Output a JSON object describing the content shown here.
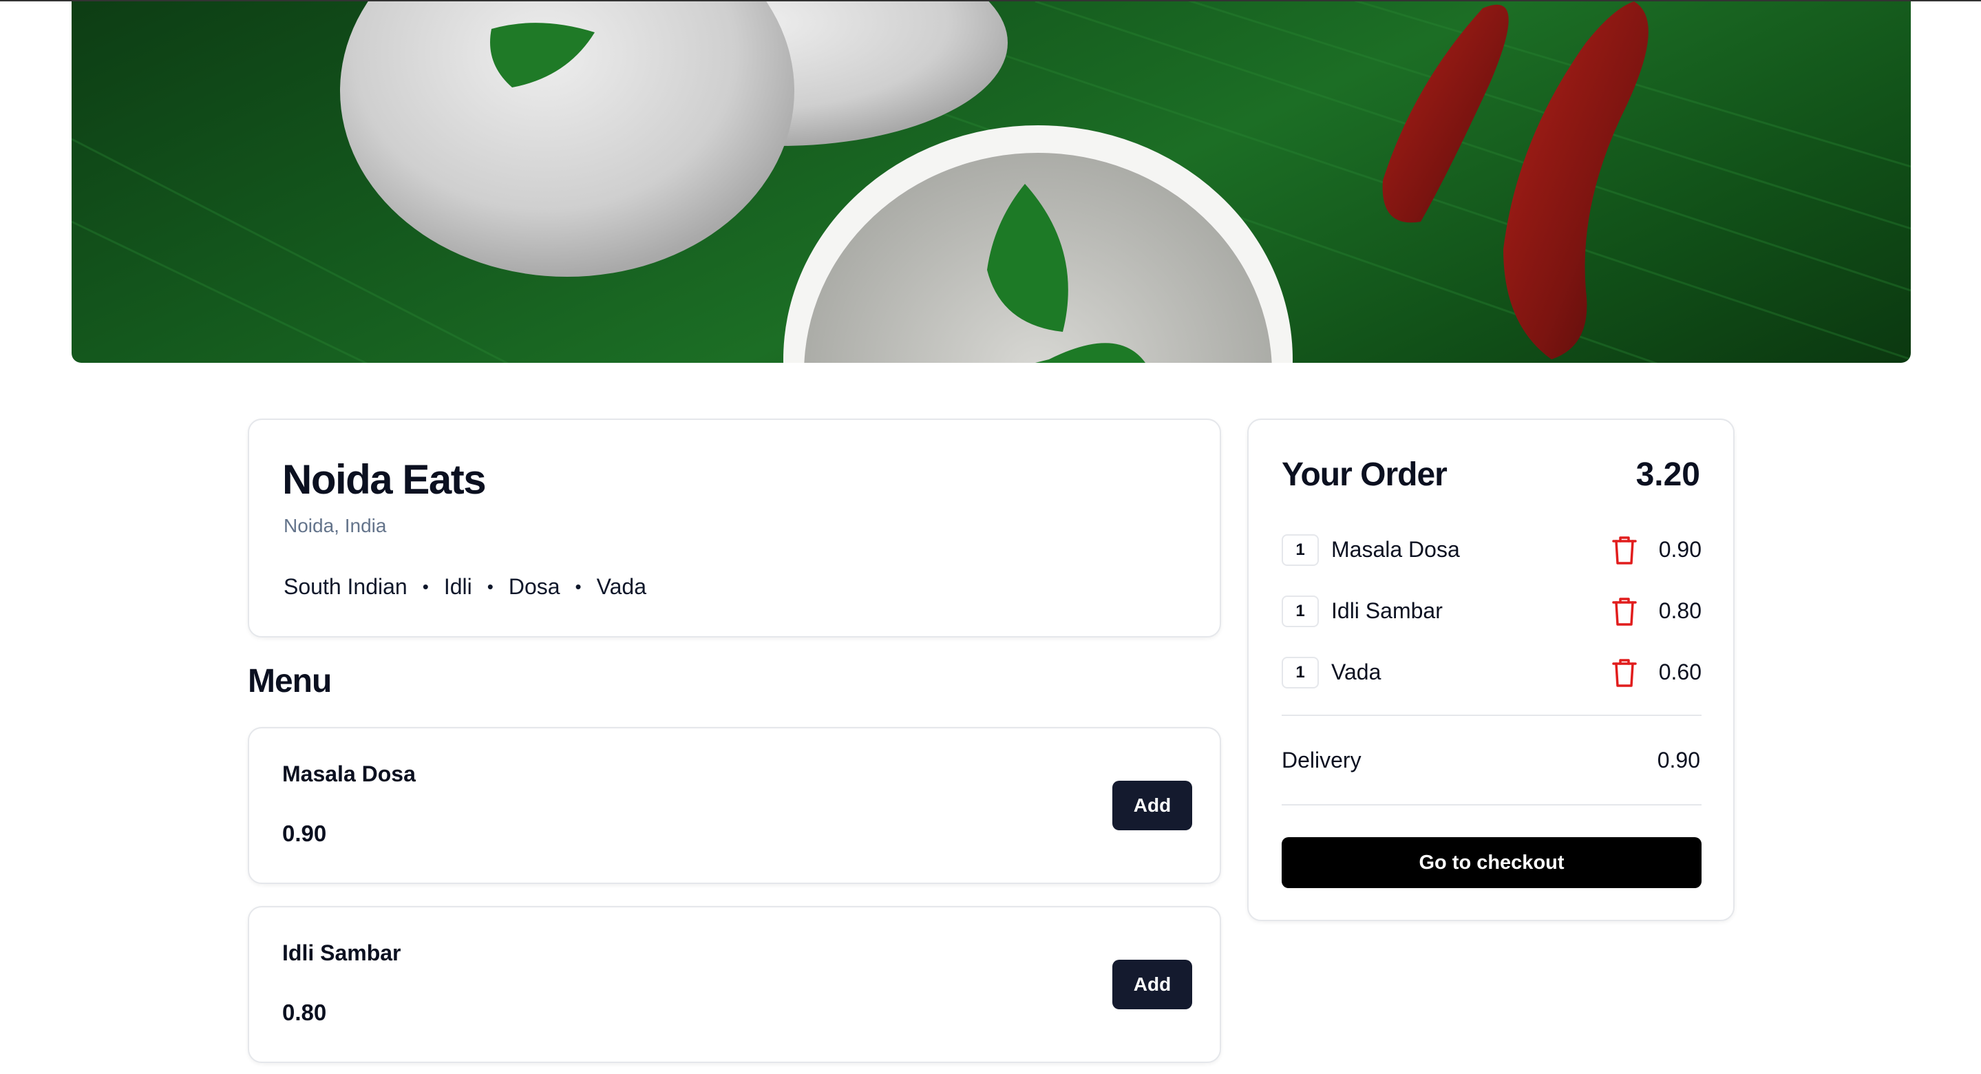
{
  "restaurant": {
    "name": "Noida Eats",
    "location": "Noida, India",
    "tags": [
      "South Indian",
      "Idli",
      "Dosa",
      "Vada"
    ],
    "tag_separator": "•"
  },
  "menu": {
    "heading": "Menu",
    "items": [
      {
        "name": "Masala Dosa",
        "price": "0.90",
        "add_label": "Add"
      },
      {
        "name": "Idli Sambar",
        "price": "0.80",
        "add_label": "Add"
      }
    ]
  },
  "order": {
    "title": "Your Order",
    "total": "3.20",
    "items": [
      {
        "qty": "1",
        "name": "Masala Dosa",
        "price": "0.90"
      },
      {
        "qty": "1",
        "name": "Idli Sambar",
        "price": "0.80"
      },
      {
        "qty": "1",
        "name": "Vada",
        "price": "0.60"
      }
    ],
    "delivery_label": "Delivery",
    "delivery_price": "0.90",
    "checkout_label": "Go to checkout"
  },
  "icons": {
    "remove_item": "trash-icon"
  },
  "colors": {
    "primary_button": "#141a2e",
    "checkout_button": "#000000",
    "trash_icon": "#e11d1d",
    "muted_text": "#64748b"
  }
}
